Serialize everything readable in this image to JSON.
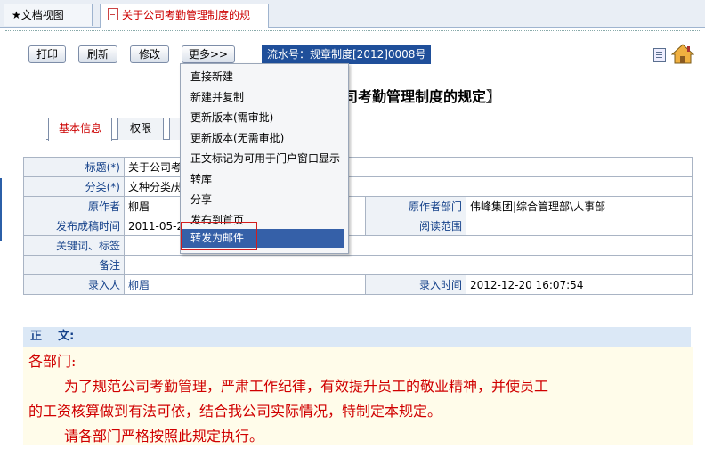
{
  "tabs": [
    {
      "label": "★文档视图"
    },
    {
      "label": "关于公司考勤管理制度的规"
    }
  ],
  "toolbar": {
    "print": "打印",
    "refresh": "刷新",
    "edit": "修改",
    "more": "更多>>",
    "serial": "流水号：规章制度[2012]0008号"
  },
  "doc_title": "司考勤管理制度的规定〗",
  "info_tabs": [
    {
      "label": "基本信息"
    },
    {
      "label": "权限"
    }
  ],
  "info": {
    "title_label": "标题(*)",
    "title_value": "关于公司考勤",
    "category_label": "分类(*)",
    "category_value": "文种分类/规",
    "author_label": "原作者",
    "author_value": "柳眉",
    "dept_label": "原作者部门",
    "dept_value": "伟峰集团|综合管理部\\人事部",
    "pubtime_label": "发布成稿时间",
    "pubtime_value": "2011-05-20",
    "scope_label": "阅读范围",
    "scope_value": "",
    "keywords_label": "关键词、标签",
    "keywords_value": "",
    "remark_label": "备注",
    "remark_value": "",
    "entry_label": "录入人",
    "entry_value": "柳眉",
    "entrytime_label": "录入时间",
    "entrytime_value": "2012-12-20 16:07:54"
  },
  "body": {
    "heading": "正    文:",
    "line1": "各部门:",
    "line2": "为了规范公司考勤管理，严肃工作纪律，有效提升员工的敬业精神，并使员工",
    "line3": "的工资核算做到有法可依，结合我公司实际情况，特制定本规定。",
    "line4": "请各部门严格按照此规定执行。"
  },
  "menu": [
    {
      "label": "直接新建"
    },
    {
      "label": "新建并复制"
    },
    {
      "label": "更新版本(需审批)"
    },
    {
      "label": "更新版本(无需审批)"
    },
    {
      "label": "正文标记为可用于门户窗口显示"
    },
    {
      "label": "转库"
    },
    {
      "label": "分享"
    },
    {
      "label": "发布到首页"
    },
    {
      "label": "转发为邮件",
      "selected": true
    }
  ],
  "colors": {
    "accent": "#1f4f9a",
    "menu_selected": "#3560a8",
    "highlight_outline": "#d31c1c",
    "body_text": "#d00000"
  }
}
